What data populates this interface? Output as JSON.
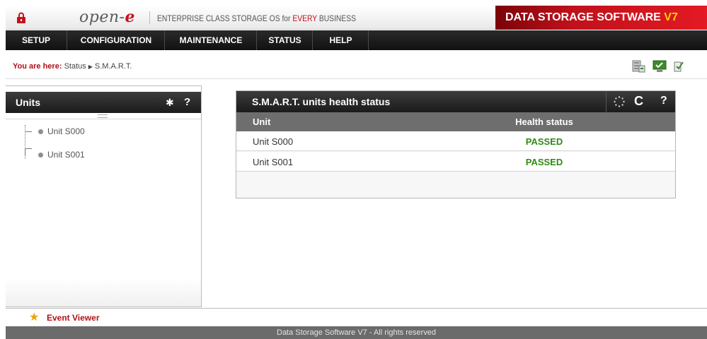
{
  "header": {
    "brand": "open-",
    "brand_e": "e",
    "tagline_prefix": "ENTERPRISE CLASS STORAGE OS for ",
    "tagline_highlight": "EVERY",
    "tagline_suffix": " BUSINESS",
    "product": "DATA STORAGE SOFTWARE ",
    "product_version": "V7"
  },
  "nav": {
    "items": [
      {
        "label": "SETUP"
      },
      {
        "label": "CONFIGURATION"
      },
      {
        "label": "MAINTENANCE"
      },
      {
        "label": "STATUS"
      },
      {
        "label": "HELP"
      }
    ]
  },
  "breadcrumb": {
    "label": "You are here:",
    "path": [
      "Status",
      "S.M.A.R.T."
    ]
  },
  "units_panel": {
    "title": "Units",
    "items": [
      {
        "label": "Unit S000"
      },
      {
        "label": "Unit S001"
      }
    ]
  },
  "smart_panel": {
    "title": "S.M.A.R.T. units health status",
    "col_unit": "Unit",
    "col_health": "Health status",
    "rows": [
      {
        "unit": "Unit S000",
        "health": "PASSED"
      },
      {
        "unit": "Unit S001",
        "health": "PASSED"
      }
    ]
  },
  "event_viewer": {
    "label": "Event Viewer"
  },
  "footer": {
    "text": "Data Storage Software V7 - All rights reserved"
  },
  "colors": {
    "accent": "#c8101e",
    "passed": "#2f8a14",
    "star": "#f0a30a"
  }
}
